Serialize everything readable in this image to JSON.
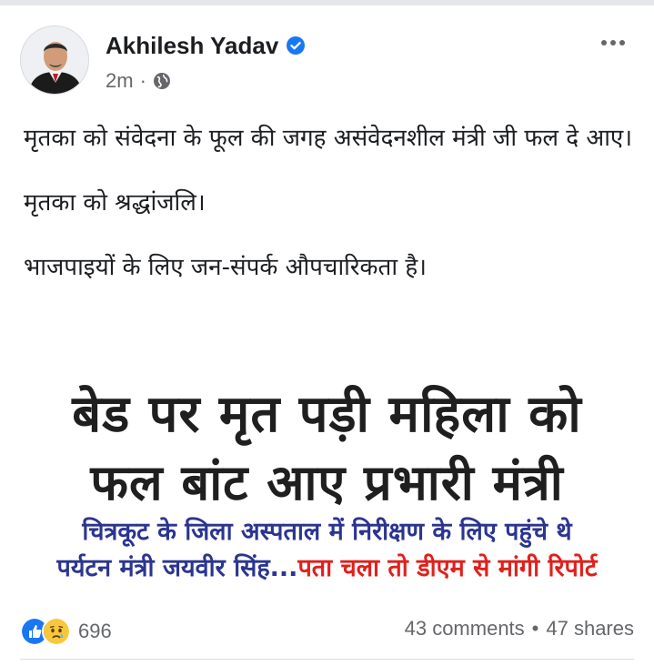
{
  "post": {
    "author": "Akhilesh Yadav",
    "timestamp": "2m",
    "separator": "·",
    "privacy_icon": "globe-icon",
    "verified_icon": "verified-badge-icon",
    "more_icon": "more-options-icon",
    "text": [
      "मृतका को संवेदना के फूल की जगह असंवेदनशील मंत्री जी फल दे आए।",
      "मृतका को श्रद्धांजलि।",
      "भाजपाइयों के लिए जन-संपर्क औपचारिकता है।"
    ]
  },
  "image": {
    "headline_line1": "बेड पर मृत पड़ी महिला को",
    "headline_line2": "फल बांट आए प्रभारी मंत्री",
    "subline1": "चित्रकूट के जिला अस्पताल में निरीक्षण के लिए पहुंचे थे",
    "subline2_part1": "पर्यटन मंत्री जयवीर सिंह...",
    "subline2_part2": "पता चला तो डीएम से मांगी रिपोर्ट",
    "colors": {
      "headline": "#1f1f1f",
      "blue": "#2b3590",
      "red": "#e0201c"
    }
  },
  "footer": {
    "reaction_icons": [
      "like-icon",
      "sad-icon"
    ],
    "reaction_count": "696",
    "comments": "43 comments",
    "dot": "•",
    "shares": "47 shares"
  },
  "colors": {
    "accent": "#1877f2",
    "secondary_text": "#65676b"
  }
}
